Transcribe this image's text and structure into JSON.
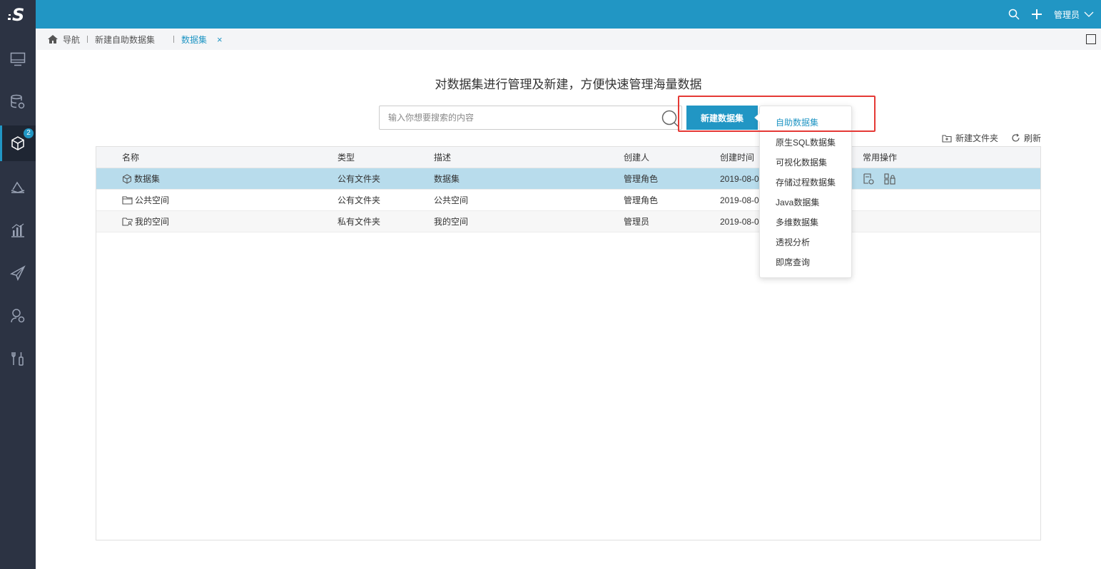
{
  "topbar": {
    "user_name": "管理员"
  },
  "sidebar": {
    "badge_count": "2"
  },
  "breadcrumb": {
    "items": [
      "导航",
      "新建自助数据集",
      "数据集"
    ],
    "close": "×"
  },
  "main": {
    "headline": "对数据集进行管理及新建，方便快速管理海量数据",
    "search_placeholder": "输入你想要搜索的内容",
    "new_button": "新建数据集",
    "new_folder": "新建文件夹",
    "refresh": "刷新"
  },
  "table": {
    "headers": [
      "名称",
      "类型",
      "描述",
      "创建人",
      "创建时间",
      "常用操作"
    ],
    "rows": [
      {
        "name": "数据集",
        "type": "公有文件夹",
        "desc": "数据集",
        "creator": "管理角色",
        "time": "2019-08-0"
      },
      {
        "name": "公共空间",
        "type": "公有文件夹",
        "desc": "公共空间",
        "creator": "管理角色",
        "time": "2019-08-0"
      },
      {
        "name": "我的空间",
        "type": "私有文件夹",
        "desc": "我的空间",
        "creator": "管理员",
        "time": "2019-08-0"
      }
    ]
  },
  "menu": {
    "items": [
      "自助数据集",
      "原生SQL数据集",
      "可视化数据集",
      "存储过程数据集",
      "Java数据集",
      "多维数据集",
      "透视分析",
      "即席查询"
    ]
  },
  "colors": {
    "accent": "#2196c4",
    "sidebar": "#2c3343",
    "highlight": "#e53935",
    "selected_row": "#b8dcec"
  }
}
